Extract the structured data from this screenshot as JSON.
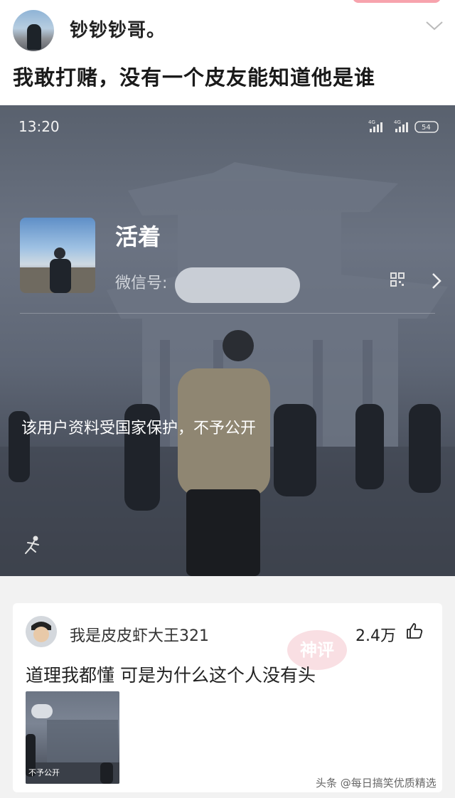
{
  "post": {
    "author_name": "钞钞钞哥。",
    "title": "我敢打赌，没有一个皮友能知道他是谁"
  },
  "screenshot": {
    "status_time": "13:20",
    "battery": "54",
    "signal_label": "4G",
    "profile_name": "活着",
    "wechat_id_label": "微信号:",
    "protected_text": "该用户资料受国家保护，不予公开"
  },
  "comment": {
    "username": "我是皮皮虾大王321",
    "likes": "2.4万",
    "stamp_text": "神评",
    "text": "道理我都懂  可是为什么这个人没有头",
    "thumb_caption": "不予公开"
  },
  "watermark": "头条 @每日搞笑优质精选",
  "colors": {
    "accent_pink": "#f7a3ad",
    "stamp_red": "#e05a6a",
    "text_dark": "#222222",
    "background": "#f2f2f2"
  },
  "icons": [
    "chevron-down-icon",
    "signal-icon",
    "battery-icon",
    "qr-code-icon",
    "chevron-right-icon",
    "running-man-icon",
    "thumbs-up-icon"
  ]
}
